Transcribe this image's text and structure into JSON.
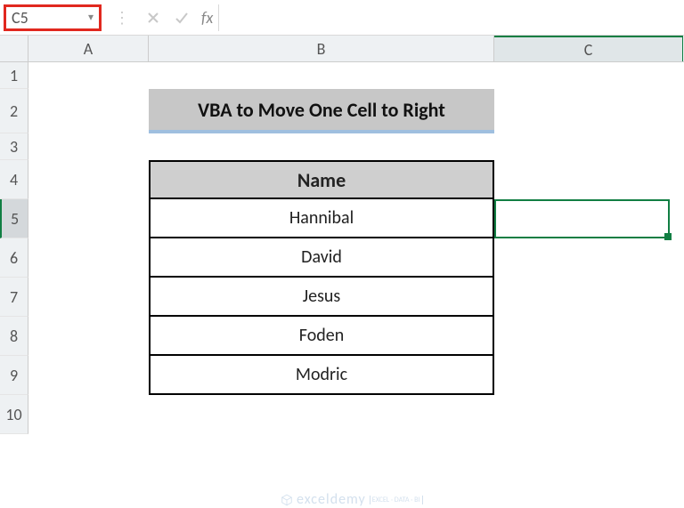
{
  "formulaBar": {
    "nameBoxValue": "C5",
    "fxLabel": "fx",
    "inputValue": ""
  },
  "columns": {
    "a": "A",
    "b": "B",
    "c": "C"
  },
  "rows": {
    "r1": "1",
    "r2": "2",
    "r3": "3",
    "r4": "4",
    "r5": "5",
    "r6": "6",
    "r7": "7",
    "r8": "8",
    "r9": "9",
    "r10": "10"
  },
  "title": "VBA to Move One Cell to Right",
  "table": {
    "header": "Name",
    "rows": [
      "Hannibal",
      "David",
      "Jesus",
      "Foden",
      "Modric"
    ]
  },
  "selection": {
    "cell": "C5"
  },
  "watermark": {
    "brand": "exceldemy",
    "tagline": "EXCEL · DATA · BI"
  },
  "chart_data": {
    "type": "table",
    "title": "VBA to Move One Cell to Right",
    "columns": [
      "Name"
    ],
    "rows": [
      [
        "Hannibal"
      ],
      [
        "David"
      ],
      [
        "Jesus"
      ],
      [
        "Foden"
      ],
      [
        "Modric"
      ]
    ]
  }
}
